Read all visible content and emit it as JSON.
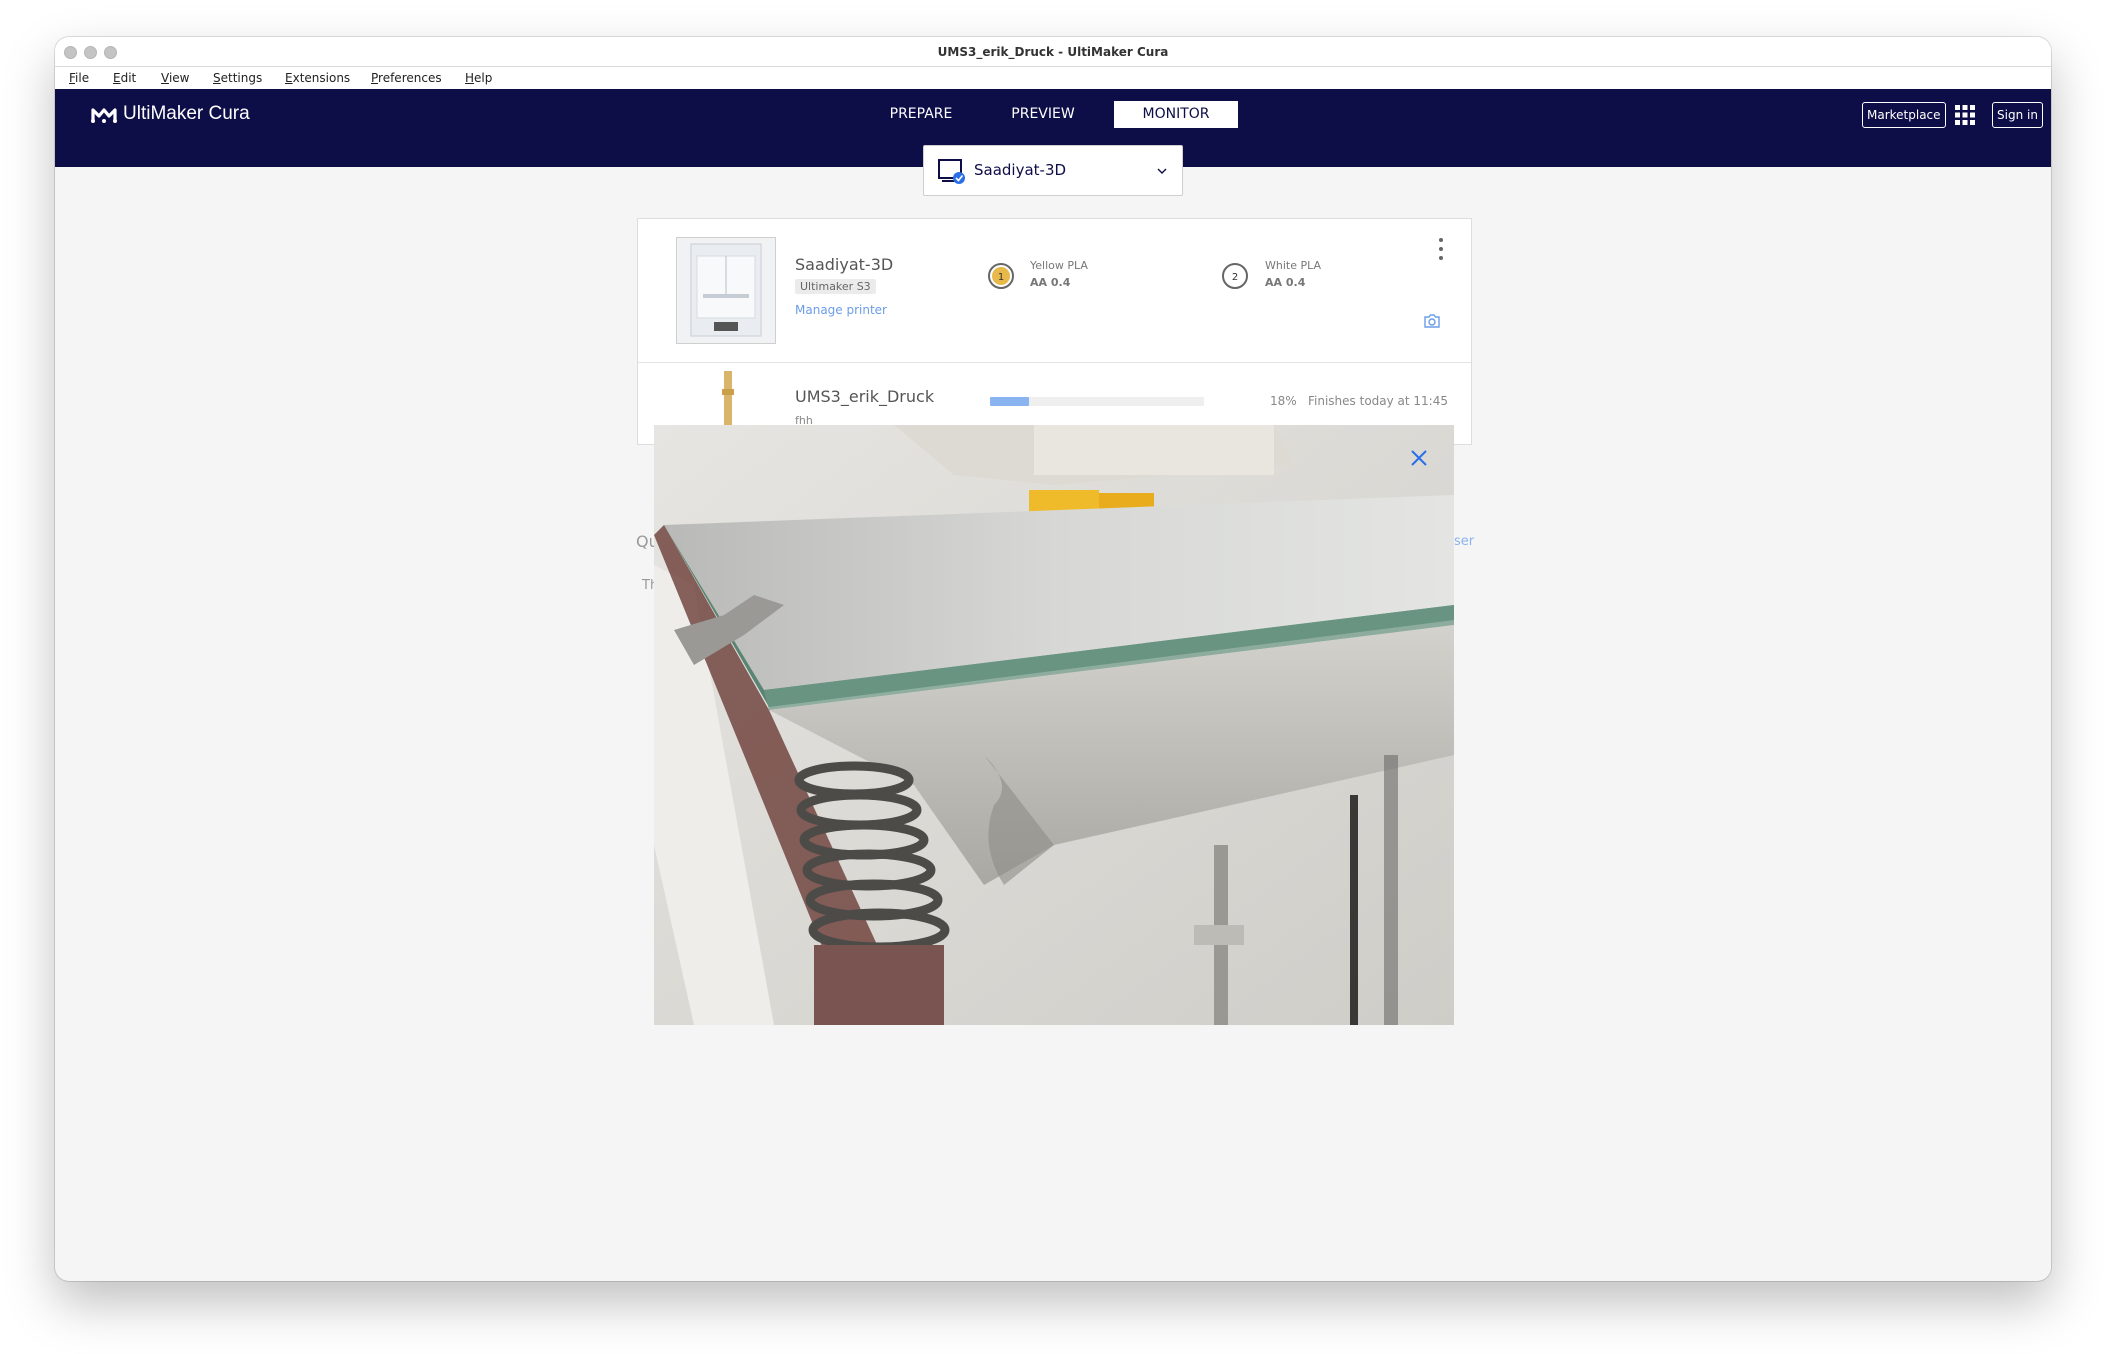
{
  "window": {
    "title": "UMS3_erik_Druck - UltiMaker Cura"
  },
  "menu": [
    "File",
    "Edit",
    "View",
    "Settings",
    "Extensions",
    "Preferences",
    "Help"
  ],
  "header": {
    "logo_text": "UltiMaker Cura",
    "stages": [
      {
        "label": "PREPARE",
        "active": false
      },
      {
        "label": "PREVIEW",
        "active": false
      },
      {
        "label": "MONITOR",
        "active": true
      }
    ],
    "marketplace_label": "Marketplace",
    "sign_in_label": "Sign in",
    "apps_icon": "grid-icon"
  },
  "printer_selector": {
    "selected": "Saadiyat-3D",
    "icon": "connected-printer-icon"
  },
  "printer_card": {
    "name": "Saadiyat-3D",
    "type": "Ultimaker S3",
    "manage_link": "Manage printer",
    "extruders": [
      {
        "number": "1",
        "material": "Yellow PLA",
        "core": "AA 0.4",
        "color": "#e8b84a"
      },
      {
        "number": "2",
        "material": "White PLA",
        "core": "AA 0.4",
        "color": "#ffffff"
      }
    ]
  },
  "print_job": {
    "name": "UMS3_erik_Druck",
    "owner": "fhh",
    "progress_pct": 18,
    "progress_label": "18%",
    "eta": "Finishes today at 11:45"
  },
  "background_text": {
    "queue_heading_fragment": "Qu",
    "queue_text_fragment": "Th",
    "browser_link_fragment": "ser"
  },
  "colors": {
    "header_bg": "#0d0d48",
    "accent": "#2a6ee8",
    "progress": "#8ab4f0"
  }
}
